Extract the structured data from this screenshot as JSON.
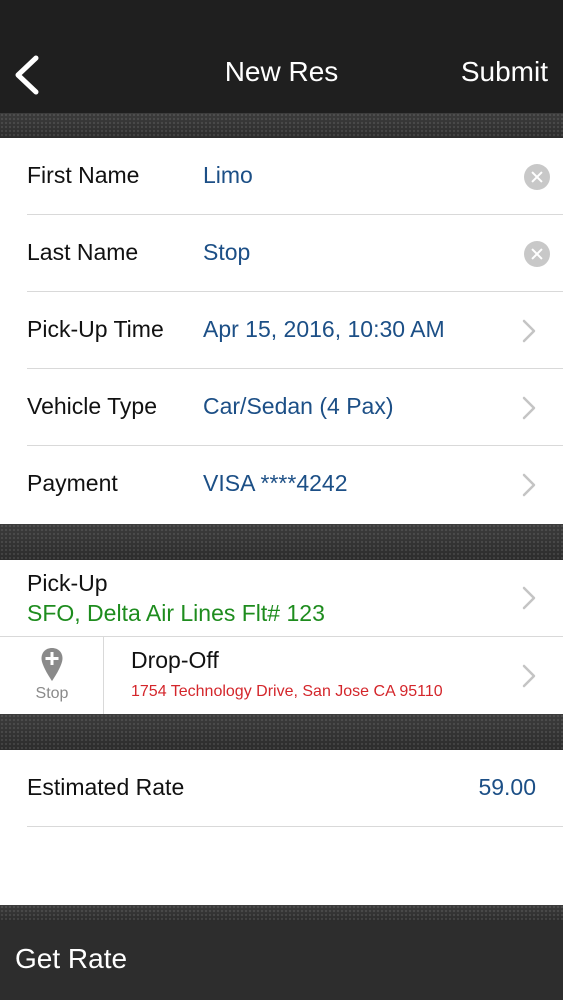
{
  "nav": {
    "title": "New Res",
    "submit_label": "Submit"
  },
  "details": {
    "first_name": {
      "label": "First Name",
      "value": "Limo"
    },
    "last_name": {
      "label": "Last Name",
      "value": "Stop"
    },
    "pickup_time": {
      "label": "Pick-Up Time",
      "value": "Apr 15, 2016, 10:30 AM"
    },
    "vehicle_type": {
      "label": "Vehicle Type",
      "value": "Car/Sedan (4 Pax)"
    },
    "payment": {
      "label": "Payment",
      "value": "VISA ****4242"
    }
  },
  "route": {
    "pickup": {
      "label": "Pick-Up",
      "value": "SFO, Delta Air Lines Flt# 123"
    },
    "stop_label": "Stop",
    "dropoff": {
      "label": "Drop-Off",
      "value": "1754 Technology Drive, San Jose CA 95110"
    }
  },
  "rate": {
    "label": "Estimated Rate",
    "value": "59.00"
  },
  "bottom": {
    "get_rate_label": "Get Rate"
  },
  "colors": {
    "value_blue": "#1c4f86",
    "pickup_green": "#1e8c1e",
    "dropoff_red": "#d4262b",
    "bar_dark": "#1f1f1f"
  }
}
